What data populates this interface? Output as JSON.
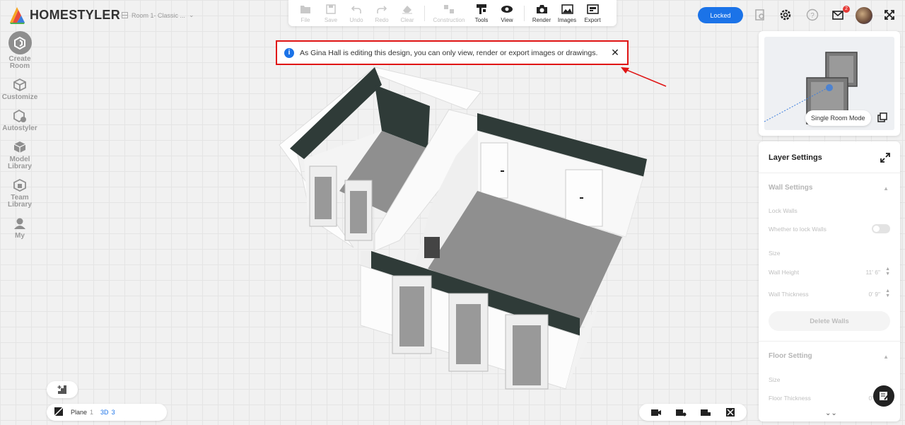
{
  "app": {
    "brand": "HOMESTYLER",
    "room_name": "Room 1- Classic ...",
    "dropdown_glyph": "⌄"
  },
  "left_nav": [
    {
      "name": "create-room",
      "label": "Create Room",
      "icon": "create-room-icon"
    },
    {
      "name": "customize",
      "label": "Customize",
      "icon": "cube-icon"
    },
    {
      "name": "autostyler",
      "label": "Autostyler",
      "icon": "autostyler-icon"
    },
    {
      "name": "model-library",
      "label": "Model Library",
      "icon": "model-library-icon"
    },
    {
      "name": "team-library",
      "label": "Team Library",
      "icon": "team-library-icon"
    },
    {
      "name": "my",
      "label": "My",
      "icon": "user-icon"
    }
  ],
  "toolbar": {
    "file": "File",
    "save": "Save",
    "undo": "Undo",
    "redo": "Redo",
    "clear": "Clear",
    "construction": "Construction",
    "tools": "Tools",
    "view": "View",
    "render": "Render",
    "images": "Images",
    "export": "Export"
  },
  "top_right": {
    "locked_label": "Locked",
    "mail_badge": "2"
  },
  "notice": {
    "text": "As Gina Hall is editing this design, you can only view, render or export images or drawings.",
    "close": "✕"
  },
  "minimap": {
    "mode_label": "Single Room Mode"
  },
  "layer_settings": {
    "title": "Layer Settings",
    "wall_settings": "Wall Settings",
    "lock_walls": "Lock Walls",
    "lock_walls_desc": "Whether to lock Walls",
    "size": "Size",
    "wall_height_label": "Wall Height",
    "wall_height_value": "11' 6\"",
    "wall_thickness_label": "Wall Thickness",
    "wall_thickness_value": "0' 9\"",
    "delete_walls": "Delete Walls",
    "floor_setting": "Floor Setting",
    "floor_size": "Size",
    "floor_thickness_label": "Floor Thickness",
    "floor_thickness_value": "0' 4\"",
    "more": "⌄⌄"
  },
  "bottom_left": {
    "plane_label": "Plane",
    "plane_num": "1",
    "three_d_label": "3D",
    "three_d_num": "3"
  },
  "colors": {
    "accent": "#1b73e8",
    "alert_border": "#e01515",
    "wall_top": "#2f3b38",
    "floor": "#8f8f8f"
  }
}
